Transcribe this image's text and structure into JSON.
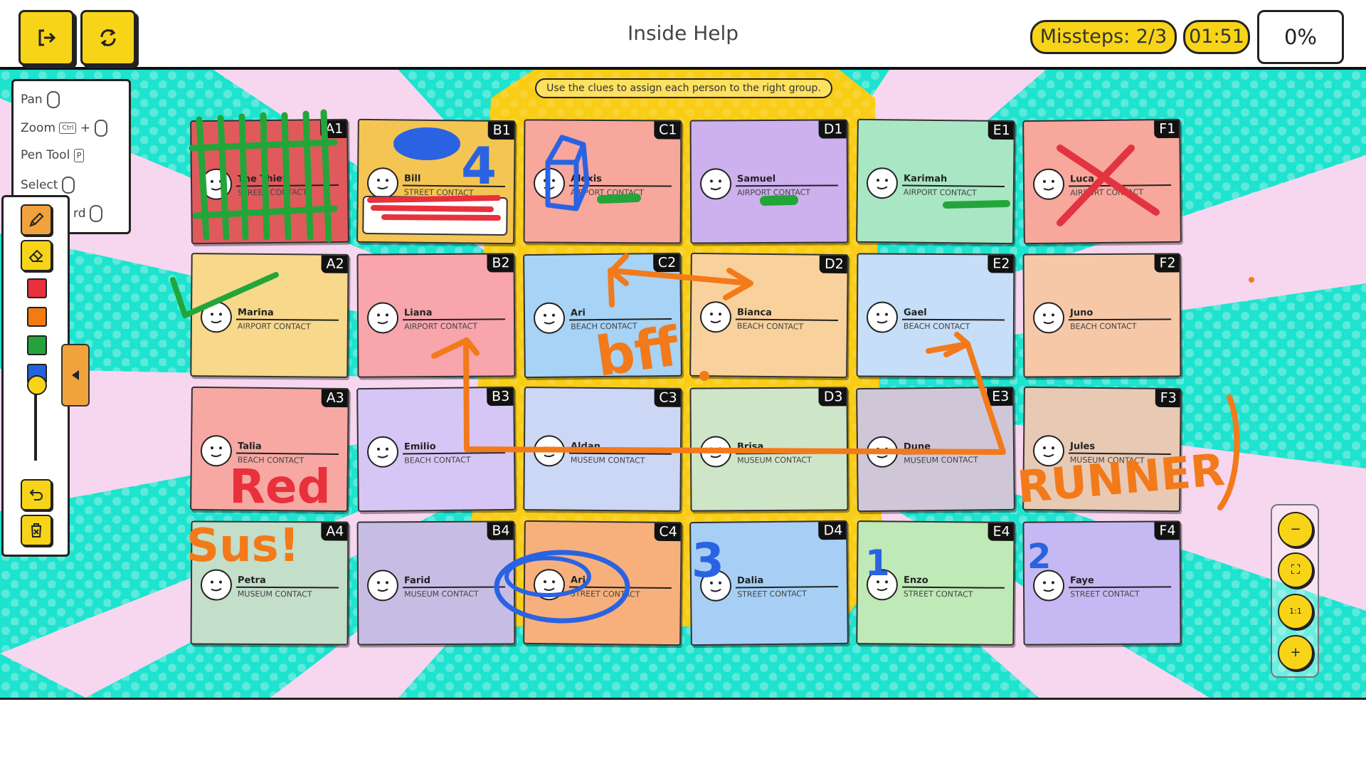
{
  "header": {
    "title": "Inside Help",
    "missteps": "Missteps: 2/3",
    "timer": "01:51",
    "progress": "0%",
    "progress_fraction": 0,
    "exit_icon": "exit-icon",
    "restart_icon": "restart-icon"
  },
  "board": {
    "hint": "Use the clues to assign each person to the right group.",
    "cards": [
      {
        "id": "A1",
        "name": "The Thief",
        "role": "STREET CONTACT",
        "color": "#e05a5c"
      },
      {
        "id": "B1",
        "name": "Bill",
        "role": "STREET CONTACT",
        "color": "#f4c552"
      },
      {
        "id": "C1",
        "name": "Alexis",
        "role": "AIRPORT CONTACT",
        "color": "#f7a79c"
      },
      {
        "id": "D1",
        "name": "Samuel",
        "role": "AIRPORT CONTACT",
        "color": "#cdb0ee"
      },
      {
        "id": "E1",
        "name": "Karimah",
        "role": "AIRPORT CONTACT",
        "color": "#a9e7c4"
      },
      {
        "id": "F1",
        "name": "Luca",
        "role": "AIRPORT CONTACT",
        "color": "#f7a79c"
      },
      {
        "id": "A2",
        "name": "Marina",
        "role": "AIRPORT CONTACT",
        "color": "#f8d88a"
      },
      {
        "id": "B2",
        "name": "Liana",
        "role": "AIRPORT CONTACT",
        "color": "#f8a5ac"
      },
      {
        "id": "C2",
        "name": "Ari",
        "role": "BEACH CONTACT",
        "color": "#a6d3f6"
      },
      {
        "id": "D2",
        "name": "Bianca",
        "role": "BEACH CONTACT",
        "color": "#f9d19c"
      },
      {
        "id": "E2",
        "name": "Gael",
        "role": "BEACH CONTACT",
        "color": "#c6def8"
      },
      {
        "id": "F2",
        "name": "Juno",
        "role": "BEACH CONTACT",
        "color": "#f7c8a8"
      },
      {
        "id": "A3",
        "name": "Talia",
        "role": "BEACH CONTACT",
        "color": "#f7a8a3"
      },
      {
        "id": "B3",
        "name": "Emilio",
        "role": "BEACH CONTACT",
        "color": "#d6c6f5"
      },
      {
        "id": "C3",
        "name": "Aldan",
        "role": "MUSEUM CONTACT",
        "color": "#ccd7f6"
      },
      {
        "id": "D3",
        "name": "Brisa",
        "role": "MUSEUM CONTACT",
        "color": "#cfe5c8"
      },
      {
        "id": "E3",
        "name": "Dune",
        "role": "MUSEUM CONTACT",
        "color": "#cfc6d8"
      },
      {
        "id": "F3",
        "name": "Jules",
        "role": "MUSEUM CONTACT",
        "color": "#e8c9b4"
      },
      {
        "id": "A4",
        "name": "Petra",
        "role": "MUSEUM CONTACT",
        "color": "#c3dec9"
      },
      {
        "id": "B4",
        "name": "Farid",
        "role": "MUSEUM CONTACT",
        "color": "#c7bde4"
      },
      {
        "id": "C4",
        "name": "Ari",
        "role": "STREET CONTACT",
        "color": "#f7b07c"
      },
      {
        "id": "D4",
        "name": "Dalia",
        "role": "STREET CONTACT",
        "color": "#a7cff5"
      },
      {
        "id": "E4",
        "name": "Enzo",
        "role": "STREET CONTACT",
        "color": "#bfe9b6"
      },
      {
        "id": "F4",
        "name": "Faye",
        "role": "STREET CONTACT",
        "color": "#c6b8f2"
      }
    ],
    "doodles": {
      "red_word": "Red",
      "sus_word": "Sus!",
      "bff_word": "bff",
      "runner_word": "RUNNER",
      "num_4": "4",
      "num_3": "3",
      "num_1": "1",
      "num_2": "2"
    }
  },
  "help": {
    "pan": "Pan",
    "zoom": "Zoom",
    "ctrl_key": "Ctrl",
    "plus": "+",
    "pen_tool": "Pen Tool",
    "pen_key": "P",
    "select": "Select",
    "partial": "rd"
  },
  "toolbar": {
    "pen_icon": "pencil-icon",
    "eraser_icon": "eraser-icon",
    "colors": [
      "#e8313c",
      "#f47a12",
      "#23a33a",
      "#2463e0"
    ],
    "brush_size_fraction": 0.1,
    "undo_icon": "undo-icon",
    "clear_icon": "clear-icon"
  },
  "zoom": {
    "out": "−",
    "fit": "⛶",
    "reset": "1:1",
    "in": "+"
  }
}
